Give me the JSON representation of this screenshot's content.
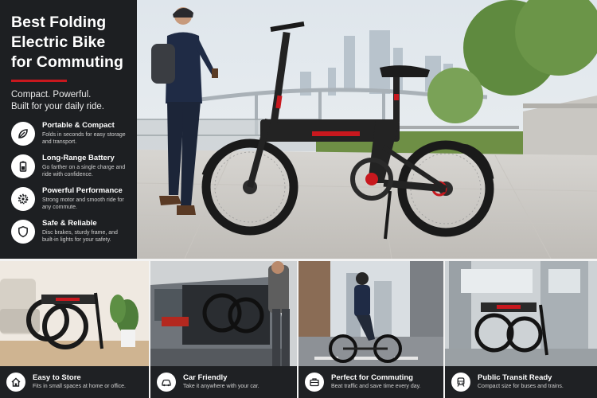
{
  "hero": {
    "headline_lines": [
      "Best Folding",
      "Electric Bike",
      "for Commuting"
    ],
    "tagline_lines": [
      "Compact. Powerful.",
      "Built for your daily ride."
    ],
    "accent_color": "#c8181e",
    "features": [
      {
        "icon": "leaf-icon",
        "title": "Portable & Compact",
        "desc": "Folds in seconds for easy storage and transport."
      },
      {
        "icon": "battery-icon",
        "title": "Long-Range Battery",
        "desc": "Go farther on a single charge and ride with confidence."
      },
      {
        "icon": "gear-icon",
        "title": "Powerful Performance",
        "desc": "Strong motor and smooth ride for any commute."
      },
      {
        "icon": "shield-icon",
        "title": "Safe & Reliable",
        "desc": "Disc brakes, sturdy frame, and built-in lights for your safety."
      }
    ]
  },
  "cards": [
    {
      "icon": "home-icon",
      "title": "Easy to Store",
      "desc": "Fits in small spaces at home or office."
    },
    {
      "icon": "car-icon",
      "title": "Car Friendly",
      "desc": "Take it anywhere with your car."
    },
    {
      "icon": "briefcase-icon",
      "title": "Perfect for Commuting",
      "desc": "Beat traffic and save time every day."
    },
    {
      "icon": "train-icon",
      "title": "Public Transit Ready",
      "desc": "Compact size for buses and trains."
    }
  ]
}
